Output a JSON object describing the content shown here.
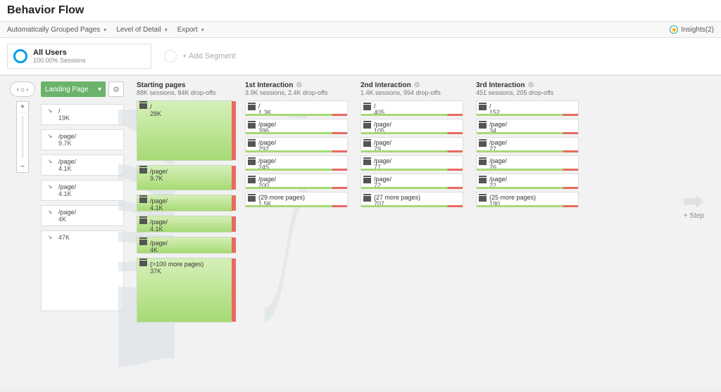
{
  "header": {
    "title": "Behavior Flow"
  },
  "toolbar": {
    "grouped": "Automatically Grouped Pages",
    "level": "Level of Detail",
    "export": "Export",
    "insights_label": "Insights(2)"
  },
  "segments": {
    "all_users_title": "All Users",
    "all_users_sub": "100.00% Sessions",
    "add_label": "+ Add Segment"
  },
  "landing": {
    "selector_label": "Landing Page",
    "items": [
      {
        "label": "/",
        "value": "19K",
        "tall": false
      },
      {
        "label": "/page/",
        "value": "9.7K",
        "tall": false
      },
      {
        "label": "/page/",
        "value": "4.1K",
        "tall": false
      },
      {
        "label": "/page/",
        "value": "4.1K",
        "tall": false
      },
      {
        "label": "/page/",
        "value": "4K",
        "tall": false
      },
      {
        "label": "",
        "value": "47K",
        "tall": true
      }
    ]
  },
  "cols": {
    "starting": {
      "title": "Starting pages",
      "sub": "88K sessions, 84K drop-offs",
      "nodes": [
        {
          "label": "/",
          "value": "28K",
          "h": "h28"
        },
        {
          "label": "/page/",
          "value": "9.7K",
          "h": "h10"
        },
        {
          "label": "/page/",
          "value": "4.1K",
          "h": "h7"
        },
        {
          "label": "/page/",
          "value": "4.1K",
          "h": "h7"
        },
        {
          "label": "/page/",
          "value": "4K",
          "h": "h7"
        },
        {
          "label": "(>100 more pages)",
          "value": "37K",
          "h": "h37"
        }
      ]
    },
    "i1": {
      "title": "1st Interaction",
      "sub": "3.9K sessions, 2.4K drop-offs",
      "nodes": [
        {
          "label": "/",
          "value": "1.3K"
        },
        {
          "label": "/page/",
          "value": "396"
        },
        {
          "label": "/page/",
          "value": "292"
        },
        {
          "label": "/page/",
          "value": "245"
        },
        {
          "label": "/page/",
          "value": "200"
        },
        {
          "label": "(29 more pages)",
          "value": "1.5K"
        }
      ]
    },
    "i2": {
      "title": "2nd Interaction",
      "sub": "1.4K sessions, 994 drop-offs",
      "nodes": [
        {
          "label": "/",
          "value": "405"
        },
        {
          "label": "/page/",
          "value": "105"
        },
        {
          "label": "/page/",
          "value": "79"
        },
        {
          "label": "/page/",
          "value": "77"
        },
        {
          "label": "/page/",
          "value": "72"
        },
        {
          "label": "(27 more pages)",
          "value": "707"
        }
      ]
    },
    "i3": {
      "title": "3rd Interaction",
      "sub": "451 sessions, 205 drop-offs",
      "nodes": [
        {
          "label": "/",
          "value": "152"
        },
        {
          "label": "/page/",
          "value": "34"
        },
        {
          "label": "/page/",
          "value": "27"
        },
        {
          "label": "/page/",
          "value": "26"
        },
        {
          "label": "/page/",
          "value": "22"
        },
        {
          "label": "(25 more pages)",
          "value": "190"
        }
      ]
    }
  },
  "step": {
    "label": "+ Step"
  }
}
